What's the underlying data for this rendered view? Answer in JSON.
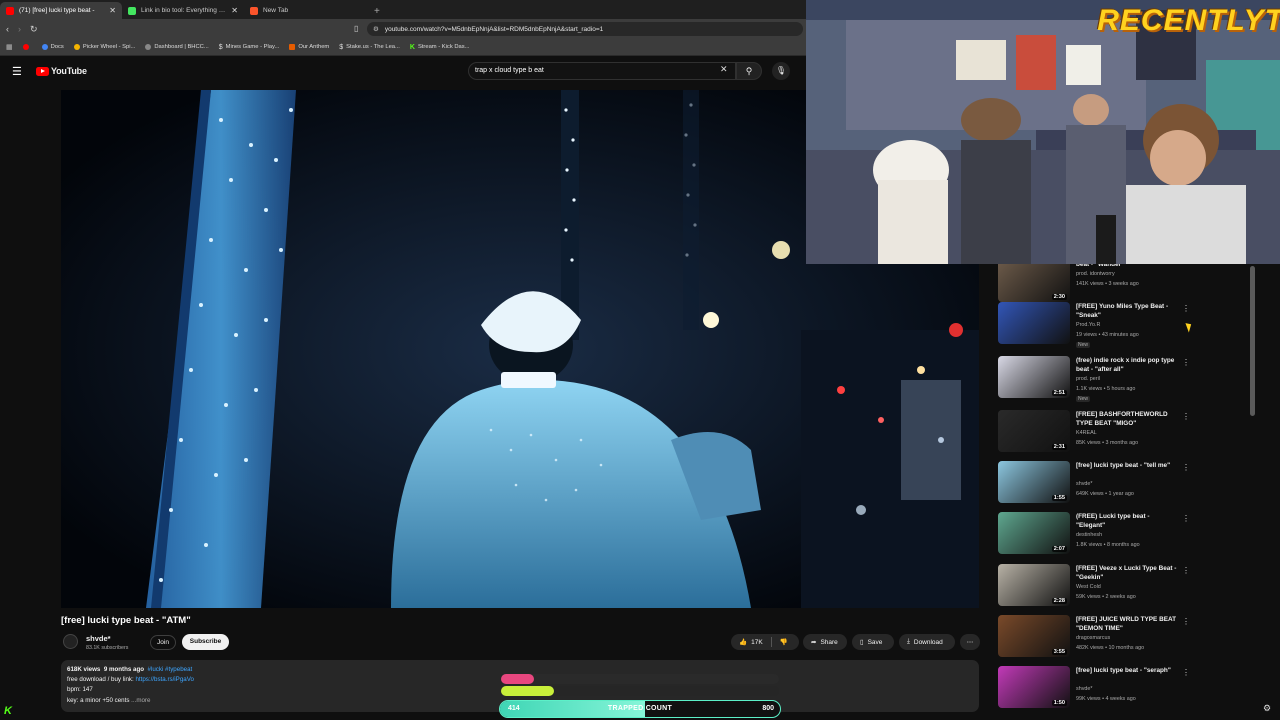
{
  "browser": {
    "tabs": [
      {
        "label": "(71) [free] lucki type beat -",
        "active": true,
        "favicon_color": "#ff0000"
      },
      {
        "label": "Link in bio tool: Everything you are",
        "active": false,
        "favicon_color": "#43e660"
      },
      {
        "label": "New Tab",
        "active": false,
        "favicon_color": "#fb542b"
      }
    ],
    "new_tab_symbol": "+",
    "url": "youtube.com/watch?v=M5dnbEpNnjA&list=RDM5dnbEpNnjA&start_radio=1",
    "bookmarks": [
      {
        "label": "",
        "color": "#ff0000"
      },
      {
        "label": "Docs",
        "color": "#4285f4"
      },
      {
        "label": "Picker Wheel - Spi...",
        "color": "#f5b400"
      },
      {
        "label": "Dashboard | BHCC...",
        "color": "#888888"
      },
      {
        "label": "Mines Game - Play...",
        "color": "#e0e0e0"
      },
      {
        "label": "Our Anthem",
        "color": "#e65c00"
      },
      {
        "label": "Stake.us - The Lea...",
        "color": "#e0e0e0"
      },
      {
        "label": "Stream - Kick Das...",
        "color": "#53fc18"
      }
    ]
  },
  "youtube": {
    "logo_text": "YouTube",
    "search_value": "trap x cloud type b eat"
  },
  "video": {
    "title": "[free] lucki type beat - \"ATM\"",
    "channel_name": "shvde*",
    "subscribers": "83.1K subscribers",
    "join_label": "Join",
    "subscribe_label": "Subscribe",
    "likes": "17K",
    "share_label": "Share",
    "save_label": "Save",
    "download_label": "Download",
    "description": {
      "views": "618K views",
      "age": "9 months ago",
      "tags": "#lucki #typebeat",
      "line2_prefix": "free download / buy link: ",
      "line2_link": "https://bsta.rs/iPgaVo",
      "line3": "bpm: 147",
      "line4": "key: a minor +50 cents",
      "more_label": "...more"
    }
  },
  "overlay": {
    "trap_current": "414",
    "trap_label": "TRAPPED COUNT",
    "trap_max": "800",
    "trap_progress": 0.5175,
    "bar1_progress": 0.12,
    "bar2_progress": 0.19,
    "stream_logo": "K"
  },
  "webcam": {
    "watermark": "RECENTLYT"
  },
  "recommendations": [
    {
      "title": "beat - \"Wander\"",
      "channel": "prod. idontworry",
      "meta": "141K views • 3 weeks ago",
      "duration": "2:30",
      "badge": "",
      "thumb": "#6d5b4a"
    },
    {
      "title": "[FREE] Yuno Miles Type Beat - \"Sneak\"",
      "channel": "Prod.Yo.R",
      "meta": "19 views • 43 minutes ago",
      "duration": "",
      "badge": "New",
      "thumb": "#3256b8"
    },
    {
      "title": "(free) indie rock x indie pop type beat - \"after all\"",
      "channel": "prod. peril",
      "meta": "1.1K views • 5 hours ago",
      "duration": "2:51",
      "badge": "New",
      "thumb": "#d9d9e6"
    },
    {
      "title": "[FREE] BASHFORTHEWORLD TYPE BEAT \"MIGO\"",
      "channel": "K4REAL",
      "meta": "85K views • 3 months ago",
      "duration": "2:31",
      "badge": "",
      "thumb": "#2a2a2a"
    },
    {
      "title": "[free] lucki type beat - \"tell me\"",
      "channel": "shvde*",
      "meta": "649K views • 1 year ago",
      "duration": "1:55",
      "badge": "",
      "thumb": "#8cc7e0"
    },
    {
      "title": "(FREE) Lucki type beat - \"Elegant\"",
      "channel": "destinhesh",
      "meta": "1.8K views • 8 months ago",
      "duration": "2:07",
      "badge": "",
      "thumb": "#5fa890"
    },
    {
      "title": "[FREE] Veeze x Lucki Type Beat - \"Geekin\"",
      "channel": "West Cold",
      "meta": "59K views • 2 weeks ago",
      "duration": "2:28",
      "badge": "",
      "thumb": "#b8b2a6"
    },
    {
      "title": "[FREE] JUICE WRLD TYPE BEAT \"DEMON TIME\"",
      "channel": "dragosmarcus",
      "meta": "482K views • 10 months ago",
      "duration": "3:55",
      "badge": "",
      "thumb": "#7a4a2a"
    },
    {
      "title": "[free] lucki type beat - \"seraph\"",
      "channel": "shvde*",
      "meta": "99K views • 4 weeks ago",
      "duration": "1:50",
      "badge": "",
      "thumb": "#c23ab8"
    }
  ]
}
